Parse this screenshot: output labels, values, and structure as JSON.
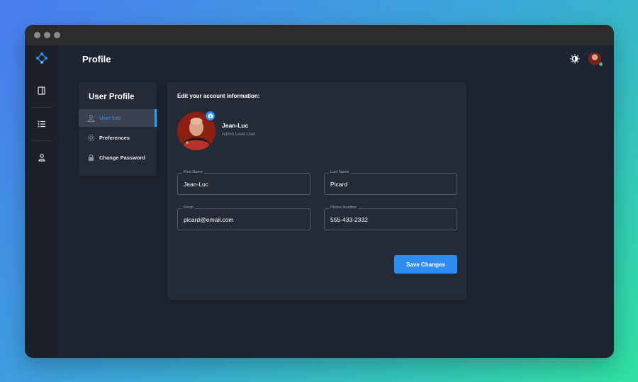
{
  "page": {
    "title": "Profile"
  },
  "sidebar_rail": {
    "items": [
      {
        "icon": "panel-icon"
      },
      {
        "icon": "list-icon"
      },
      {
        "icon": "user-icon"
      }
    ]
  },
  "profile_menu": {
    "title": "User Profile",
    "items": [
      {
        "label": "User Info",
        "icon": "user-icon",
        "active": true
      },
      {
        "label": "Preferences",
        "icon": "gear-icon",
        "active": false
      },
      {
        "label": "Change Password",
        "icon": "lock-icon",
        "active": false
      }
    ]
  },
  "form": {
    "heading": "Edit your account information:",
    "user": {
      "name": "Jean-Luc",
      "role": "Admin Level User"
    },
    "fields": {
      "first_name": {
        "label": "First Name",
        "value": "Jean-Luc"
      },
      "last_name": {
        "label": "Last Name",
        "value": "Picard"
      },
      "email": {
        "label": "Email",
        "value": "picard@email.com"
      },
      "phone": {
        "label": "Phone Number",
        "value": "555-433-2332"
      }
    },
    "save_label": "Save Changes"
  },
  "colors": {
    "accent": "#2d8df0",
    "card": "#252b36",
    "background": "#1f2530",
    "status_online": "#35c77a"
  }
}
